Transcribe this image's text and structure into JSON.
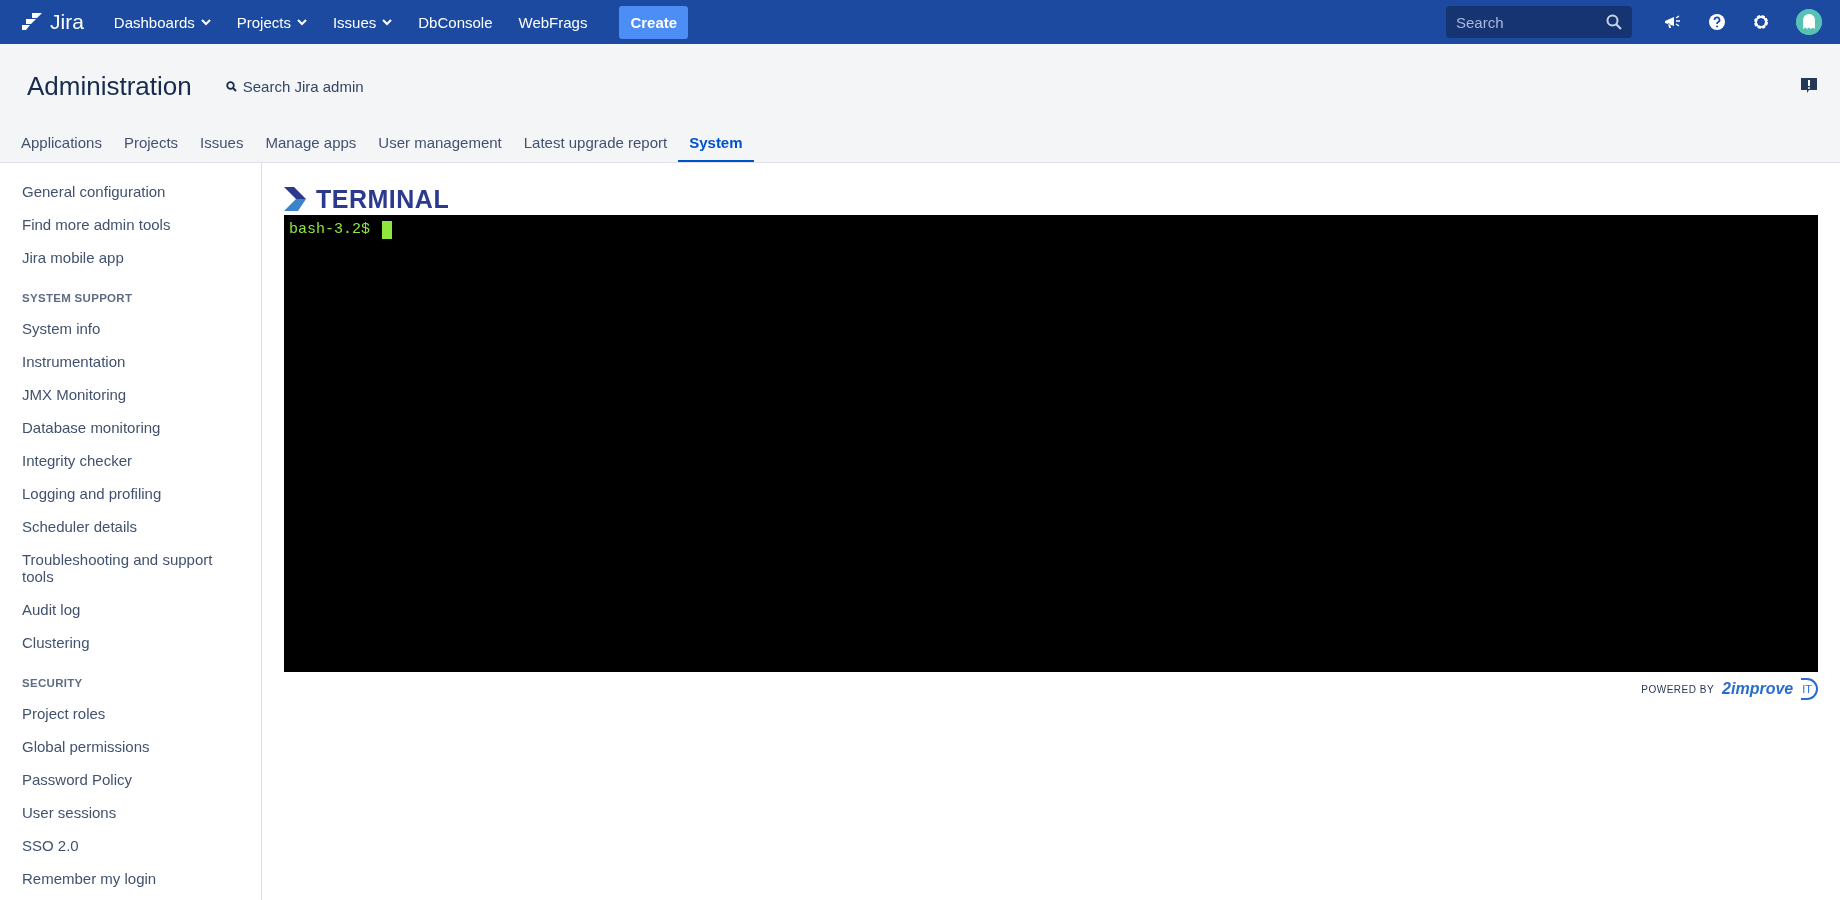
{
  "topbar": {
    "logo": "Jira",
    "nav": [
      {
        "label": "Dashboards",
        "dropdown": true
      },
      {
        "label": "Projects",
        "dropdown": true
      },
      {
        "label": "Issues",
        "dropdown": true
      },
      {
        "label": "DbConsole",
        "dropdown": false
      },
      {
        "label": "WebFrags",
        "dropdown": false
      }
    ],
    "create": "Create",
    "search": {
      "placeholder": "Search"
    }
  },
  "header": {
    "title": "Administration",
    "search": "Search Jira admin"
  },
  "tabs": [
    {
      "label": "Applications",
      "selected": false
    },
    {
      "label": "Projects",
      "selected": false
    },
    {
      "label": "Issues",
      "selected": false
    },
    {
      "label": "Manage apps",
      "selected": false
    },
    {
      "label": "User management",
      "selected": false
    },
    {
      "label": "Latest upgrade report",
      "selected": false
    },
    {
      "label": "System",
      "selected": true
    }
  ],
  "sidebar": {
    "groups": [
      {
        "items": [
          "General configuration",
          "Find more admin tools",
          "Jira mobile app"
        ]
      },
      {
        "heading": "SYSTEM SUPPORT",
        "items": [
          "System info",
          "Instrumentation",
          "JMX Monitoring",
          "Database monitoring",
          "Integrity checker",
          "Logging and profiling",
          "Scheduler details",
          "Troubleshooting and support tools",
          "Audit log",
          "Clustering"
        ]
      },
      {
        "heading": "SECURITY",
        "items": [
          "Project roles",
          "Global permissions",
          "Password Policy",
          "User sessions",
          "SSO 2.0",
          "Remember my login"
        ]
      }
    ]
  },
  "terminal": {
    "logo": "TERMINAL",
    "prompt": "bash-3.2$",
    "powered_by": "POWERED BY",
    "vendor": "2improve",
    "vendor_mark": "IT"
  }
}
